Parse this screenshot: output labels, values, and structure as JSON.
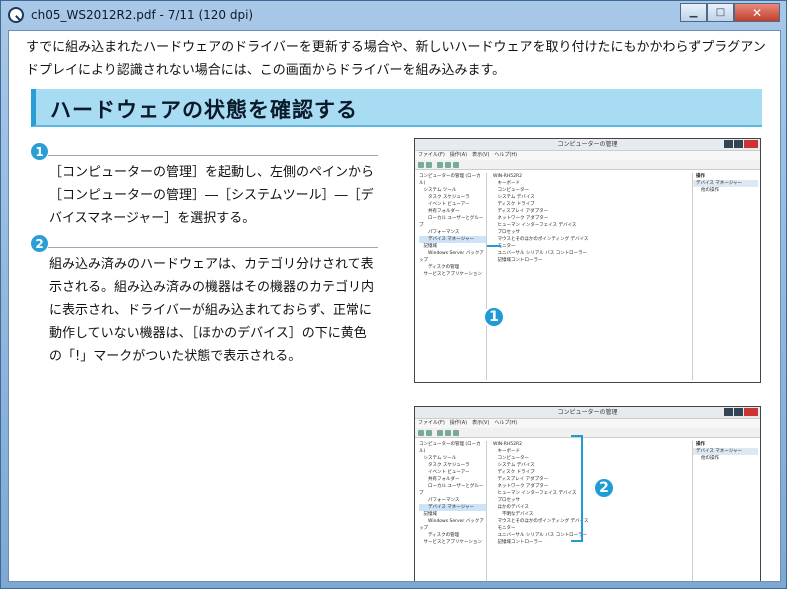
{
  "window": {
    "title": "ch05_WS2012R2.pdf - 7/11 (120 dpi)",
    "min_label": "▁",
    "max_label": "□",
    "close_label": "✕"
  },
  "intro": {
    "text": "すでに組み込まれたハードウェアのドライバーを更新する場合や、新しいハードウェアを取り付けたにもかかわらずプラグアンドプレイにより認識されない場合には、この画面からドライバーを組み込みます。"
  },
  "section": {
    "title": "ハードウェアの状態を確認する"
  },
  "steps": [
    {
      "badge": "1",
      "text": "［コンピューターの管理］を起動し、左側のペインから［コンピューターの管理］―［システムツール］―［デバイスマネージャー］を選択する。"
    },
    {
      "badge": "2",
      "text": "組み込み済みのハードウェアは、カテゴリ分けされて表示される。組み込み済みの機器はその機器のカテゴリ内に表示され、ドライバーが組み込まれておらず、正常に動作していない機器は、［ほかのデバイス］の下に黄色の「!」マークがついた状態で表示される。"
    }
  ],
  "screenshot": {
    "title": "コンピューターの管理",
    "menu": "ファイル(F)　操作(A)　表示(V)　ヘルプ(H)",
    "tree": [
      "コンピューターの管理 (ローカル)",
      "　システム ツール",
      "　　タスク スケジューラ",
      "　　イベント ビューアー",
      "　　共有フォルダー",
      "　　ローカル ユーザーとグループ",
      "　　パフォーマンス",
      "　　デバイス マネージャー",
      "　記憶域",
      "　　Windows Server バックアップ",
      "　　ディスクの管理",
      "　サービスとアプリケーション"
    ],
    "devices": [
      "WIN-RH52R2",
      "　キーボード",
      "　コンピューター",
      "　システム デバイス",
      "　ディスク ドライブ",
      "　ディスプレイ アダプター",
      "　ネットワーク アダプター",
      "　ヒューマン インターフェイス デバイス",
      "　プロセッサ",
      "　マウスとそのほかのポインティング デバイス",
      "　モニター",
      "　ユニバーサル シリアル バス コントローラー",
      "　記憶域コントローラー"
    ],
    "devices2": [
      "WIN-RH52R2",
      "　キーボード",
      "　コンピューター",
      "　システム デバイス",
      "　ディスク ドライブ",
      "　ディスプレイ アダプター",
      "　ネットワーク アダプター",
      "　ヒューマン インターフェイス デバイス",
      "　プロセッサ",
      "　ほかのデバイス",
      "　　不明なデバイス",
      "　マウスとそのほかのポインティング デバイス",
      "　モニター",
      "　ユニバーサル シリアル バス コントローラー",
      "　記憶域コントローラー",
      "　記憶域コントローラー"
    ],
    "ops_head": "操作",
    "ops_sel": "デバイス マネージャー",
    "ops_more": "他の操作"
  },
  "callouts": {
    "one": "1",
    "two": "2"
  }
}
